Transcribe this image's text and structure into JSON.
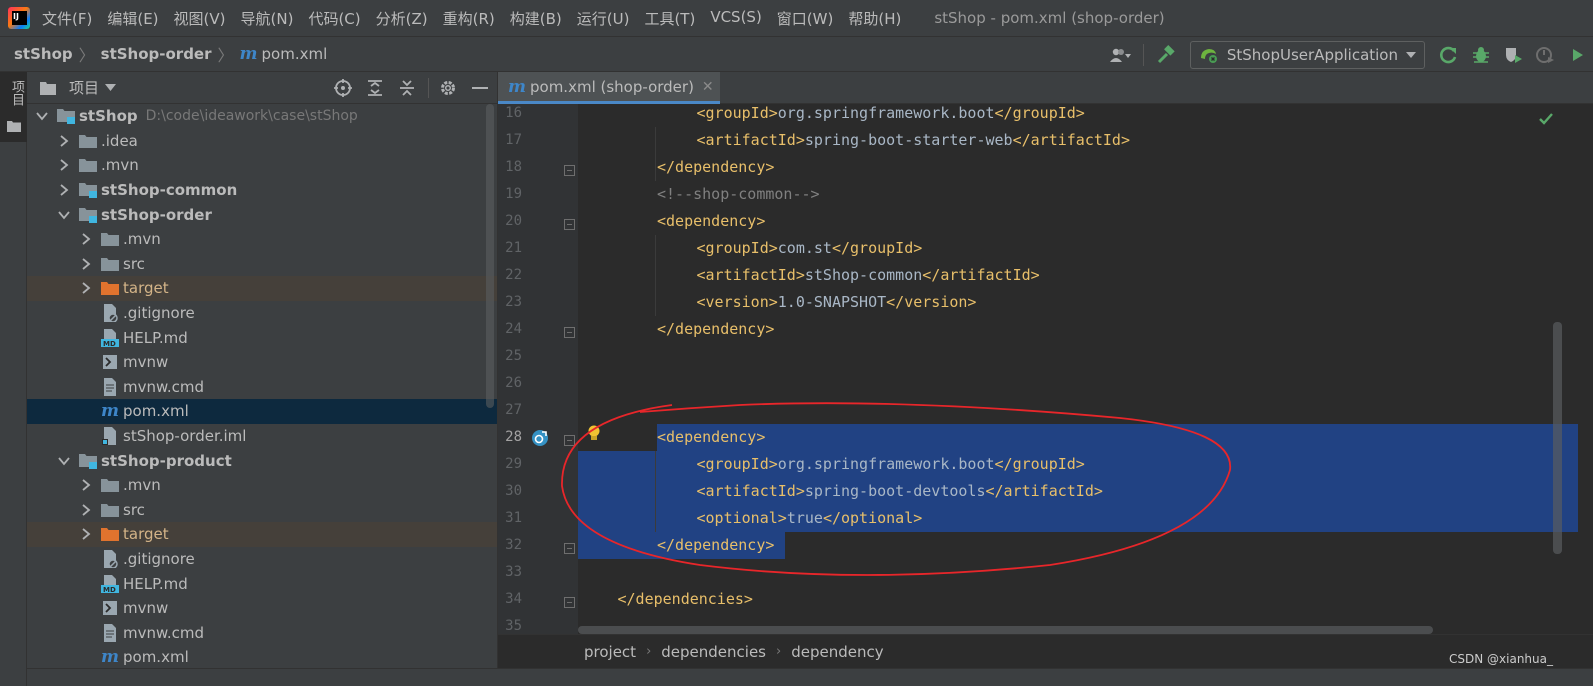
{
  "menu": {
    "items": [
      "文件(F)",
      "编辑(E)",
      "视图(V)",
      "导航(N)",
      "代码(C)",
      "分析(Z)",
      "重构(R)",
      "构建(B)",
      "运行(U)",
      "工具(T)",
      "VCS(S)",
      "窗口(W)",
      "帮助(H)"
    ],
    "window_title": "stShop - pom.xml (shop-order)"
  },
  "navbar": {
    "crumbs": [
      "stShop",
      "stShop-order"
    ],
    "file": "pom.xml",
    "run_config": "StShopUserApplication"
  },
  "left_strip": {
    "project_label": "项目"
  },
  "project_panel": {
    "title": "项目",
    "tree": [
      {
        "label": "stShop",
        "path": "D:\\code\\ideawork\\case\\stShop",
        "bold": true,
        "depth": 0,
        "expanded": true,
        "icon": "module-folder-icon"
      },
      {
        "label": ".idea",
        "depth": 1,
        "expanded": false,
        "icon": "folder-icon"
      },
      {
        "label": ".mvn",
        "depth": 1,
        "expanded": false,
        "icon": "folder-icon"
      },
      {
        "label": "stShop-common",
        "bold": true,
        "depth": 1,
        "expanded": false,
        "icon": "module-folder-icon"
      },
      {
        "label": "stShop-order",
        "bold": true,
        "depth": 1,
        "expanded": true,
        "icon": "module-folder-icon"
      },
      {
        "label": ".mvn",
        "depth": 2,
        "expanded": false,
        "icon": "folder-icon"
      },
      {
        "label": "src",
        "depth": 2,
        "expanded": false,
        "icon": "folder-icon"
      },
      {
        "label": "target",
        "depth": 2,
        "expanded": false,
        "icon": "excluded-folder-icon",
        "excluded": true
      },
      {
        "label": ".gitignore",
        "depth": 2,
        "icon": "gitignore-file-icon"
      },
      {
        "label": "HELP.md",
        "depth": 2,
        "icon": "markdown-file-icon"
      },
      {
        "label": "mvnw",
        "depth": 2,
        "icon": "shell-file-icon"
      },
      {
        "label": "mvnw.cmd",
        "depth": 2,
        "icon": "text-file-icon"
      },
      {
        "label": "pom.xml",
        "depth": 2,
        "icon": "maven-file-icon",
        "selected": true
      },
      {
        "label": "stShop-order.iml",
        "depth": 2,
        "icon": "iml-file-icon"
      },
      {
        "label": "stShop-product",
        "bold": true,
        "depth": 1,
        "expanded": true,
        "icon": "module-folder-icon"
      },
      {
        "label": ".mvn",
        "depth": 2,
        "expanded": false,
        "icon": "folder-icon"
      },
      {
        "label": "src",
        "depth": 2,
        "expanded": false,
        "icon": "folder-icon"
      },
      {
        "label": "target",
        "depth": 2,
        "expanded": false,
        "icon": "excluded-folder-icon",
        "excluded": true
      },
      {
        "label": ".gitignore",
        "depth": 2,
        "icon": "gitignore-file-icon"
      },
      {
        "label": "HELP.md",
        "depth": 2,
        "icon": "markdown-file-icon"
      },
      {
        "label": "mvnw",
        "depth": 2,
        "icon": "shell-file-icon"
      },
      {
        "label": "mvnw.cmd",
        "depth": 2,
        "icon": "text-file-icon"
      },
      {
        "label": "pom.xml",
        "depth": 2,
        "icon": "maven-file-icon"
      }
    ]
  },
  "editor": {
    "tab_label": "pom.xml (shop-order)",
    "current_line": 28,
    "lines": [
      {
        "n": 16,
        "indent": 3,
        "parts": [
          [
            "tag",
            "<groupId>"
          ],
          [
            "txt",
            "org.springframework.boot"
          ],
          [
            "tag",
            "</groupId>"
          ]
        ]
      },
      {
        "n": 17,
        "indent": 3,
        "parts": [
          [
            "tag",
            "<artifactId>"
          ],
          [
            "txt",
            "spring-boot-starter-web"
          ],
          [
            "tag",
            "</artifactId>"
          ]
        ]
      },
      {
        "n": 18,
        "indent": 2,
        "parts": [
          [
            "tag",
            "</dependency>"
          ]
        ]
      },
      {
        "n": 19,
        "indent": 2,
        "parts": [
          [
            "cmt",
            "<!--shop-common-->"
          ]
        ]
      },
      {
        "n": 20,
        "indent": 2,
        "parts": [
          [
            "tag",
            "<dependency>"
          ]
        ]
      },
      {
        "n": 21,
        "indent": 3,
        "parts": [
          [
            "tag",
            "<groupId>"
          ],
          [
            "txt",
            "com.st"
          ],
          [
            "tag",
            "</groupId>"
          ]
        ]
      },
      {
        "n": 22,
        "indent": 3,
        "parts": [
          [
            "tag",
            "<artifactId>"
          ],
          [
            "txt",
            "stShop-common"
          ],
          [
            "tag",
            "</artifactId>"
          ]
        ]
      },
      {
        "n": 23,
        "indent": 3,
        "parts": [
          [
            "tag",
            "<version>"
          ],
          [
            "txt",
            "1.0-SNAPSHOT"
          ],
          [
            "tag",
            "</version>"
          ]
        ]
      },
      {
        "n": 24,
        "indent": 2,
        "parts": [
          [
            "tag",
            "</dependency>"
          ]
        ]
      },
      {
        "n": 25,
        "indent": 0,
        "parts": []
      },
      {
        "n": 26,
        "indent": 0,
        "parts": []
      },
      {
        "n": 27,
        "indent": 0,
        "parts": []
      },
      {
        "n": 28,
        "indent": 2,
        "parts": [
          [
            "tag",
            "<dependency>"
          ]
        ]
      },
      {
        "n": 29,
        "indent": 3,
        "parts": [
          [
            "tag",
            "<groupId>"
          ],
          [
            "txt",
            "org.springframework.boot"
          ],
          [
            "tag",
            "</groupId>"
          ]
        ]
      },
      {
        "n": 30,
        "indent": 3,
        "parts": [
          [
            "tag",
            "<artifactId>"
          ],
          [
            "txt",
            "spring-boot-devtools"
          ],
          [
            "tag",
            "</artifactId>"
          ]
        ]
      },
      {
        "n": 31,
        "indent": 3,
        "parts": [
          [
            "tag",
            "<optional>"
          ],
          [
            "txt",
            "true"
          ],
          [
            "tag",
            "</optional>"
          ]
        ]
      },
      {
        "n": 32,
        "indent": 2,
        "parts": [
          [
            "tag",
            "</dependency>"
          ]
        ]
      },
      {
        "n": 33,
        "indent": 0,
        "parts": []
      },
      {
        "n": 34,
        "indent": 1,
        "parts": [
          [
            "tag",
            "</dependencies>"
          ]
        ]
      },
      {
        "n": 35,
        "indent": 0,
        "parts": []
      }
    ],
    "selection": {
      "from": 28,
      "to": 32
    },
    "breadcrumb": [
      "project",
      "dependencies",
      "dependency"
    ]
  },
  "watermark": "CSDN @xianhua_",
  "colors": {
    "tag": "#e8bf6a",
    "text": "#a9b7c6",
    "comment": "#808080",
    "selection": "#214283",
    "annotation": "#e8262a"
  }
}
